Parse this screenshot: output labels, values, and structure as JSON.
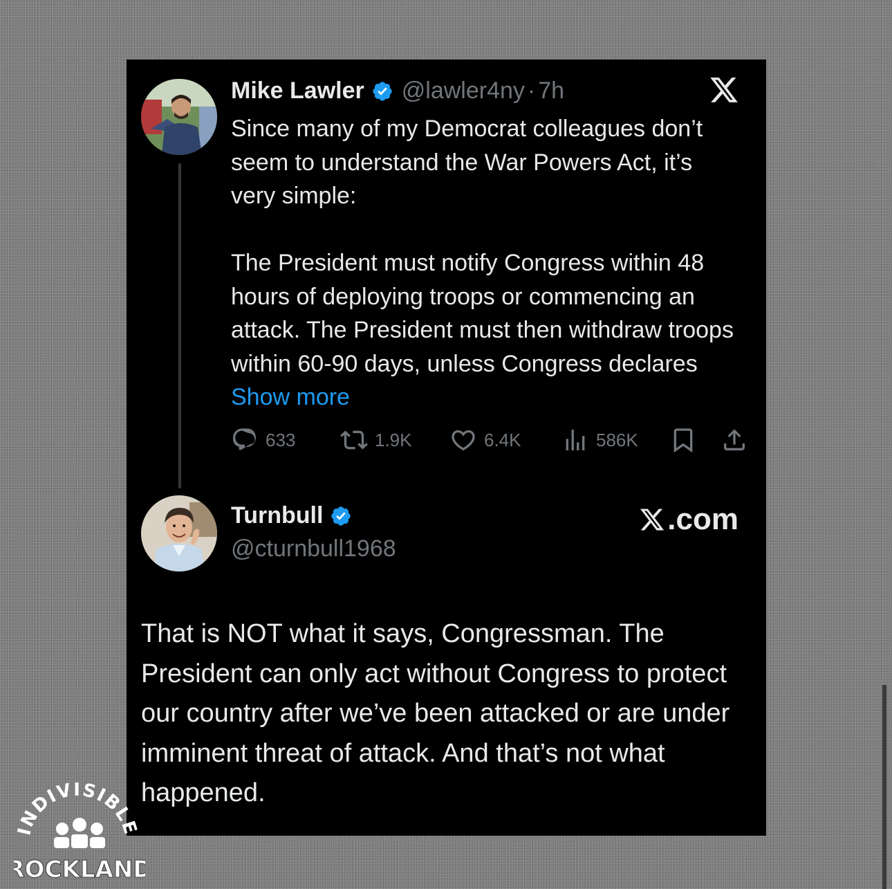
{
  "original_tweet": {
    "author_name": "Mike Lawler",
    "handle": "@lawler4ny",
    "separator": "·",
    "time": "7h",
    "paragraph1": "Since many of my Democrat colleagues don’t seem to understand the War Powers Act, it’s very simple:",
    "paragraph2": "The President must notify Congress within 48 hours of deploying troops or commencing an attack. The President must then withdraw troops within 60-90 days, unless Congress declares ",
    "show_more": "Show more",
    "stats": {
      "replies": "633",
      "reposts": "1.9K",
      "likes": "6.4K",
      "views": "586K"
    },
    "icons": [
      "verified-badge-icon",
      "x-logo-icon",
      "reply-icon",
      "repost-icon",
      "like-icon",
      "views-icon",
      "bookmark-icon",
      "share-icon"
    ]
  },
  "reply_tweet": {
    "author_name": "Turnbull",
    "handle": "@cturnbull1968",
    "text": "That is NOT what it says, Congressman. The President can only act without Congress to protect our country after we’ve been attacked or are under imminent threat of attack. And that’s not what happened."
  },
  "source_label": ".com",
  "watermark": {
    "line1": "INDIVISIBLE",
    "line2": "ROCKLAND"
  },
  "colors": {
    "card_background": "#000000",
    "text_primary": "#e7e9ea",
    "text_secondary": "#71767b",
    "link_blue": "#1d9bf0",
    "verified_blue": "#1d9bf0",
    "page_background": "#7b7b7b"
  }
}
